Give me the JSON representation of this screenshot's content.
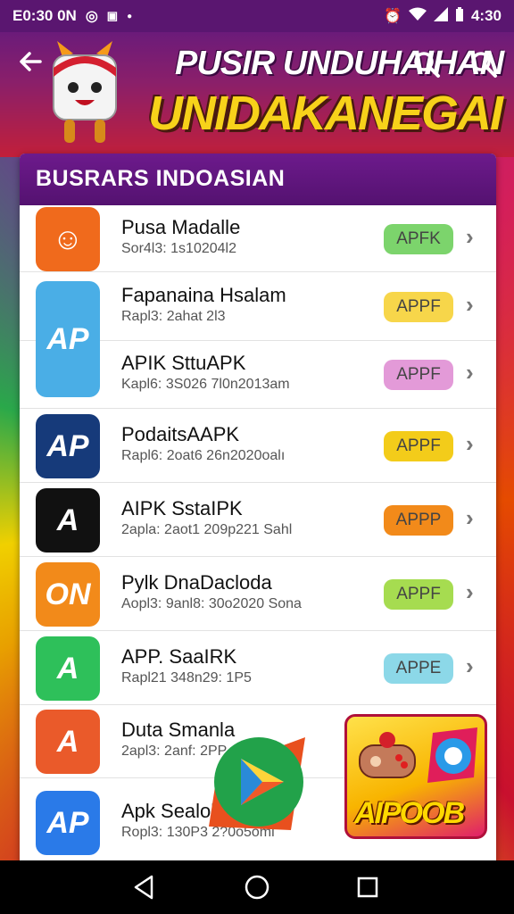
{
  "status_bar": {
    "left_text": "E0:30 0N",
    "time": "4:30"
  },
  "header": {
    "title_line1": "PUSIR UNDUHAIHAN",
    "title_line2": "UNIDAKANEGAI"
  },
  "panel": {
    "title": "BUSRARS INDOASIAN"
  },
  "apps": [
    {
      "name": "Pusa Madalle",
      "meta": "Sor4l3: 1s10204l2",
      "badge": "APFK",
      "badge_color": "#7cd46c",
      "icon_color": "#f06a1c",
      "icon_glyph": "☺"
    },
    {
      "name": "Fapanaina Hsalam",
      "meta": "Rapl3: 2ahat 2l3",
      "badge": "APPF",
      "badge_color": "#f7d64a",
      "icon_color": "#4aaee6",
      "icon_glyph": "AP"
    },
    {
      "name": "APIK SttuAPK",
      "meta": "Kapl6: 3S026 7l0n2013am",
      "badge": "APPF",
      "badge_color": "#e39ad8",
      "icon_color": "#7fcaf0",
      "icon_glyph": ""
    },
    {
      "name": "PodaitsAAPK",
      "meta": "Rapl6: 2oat6 26n2020oalı",
      "badge": "APPF",
      "badge_color": "#f3cc1a",
      "icon_color": "#163a7a",
      "icon_glyph": "AP"
    },
    {
      "name": "AIPK SstaIPK",
      "meta": "2apla: 2aot1 209p221 Sahl",
      "badge": "APPP",
      "badge_color": "#f28a1a",
      "icon_color": "#111111",
      "icon_glyph": "A"
    },
    {
      "name": "Pylk DnaDacloda",
      "meta": "Aopl3: 9anl8: 30o2020 Sona",
      "badge": "APPF",
      "badge_color": "#a6dc50",
      "icon_color": "#f28a1a",
      "icon_glyph": "ON"
    },
    {
      "name": "APP. SaaIRK",
      "meta": "Rapl21 348n29: 1P5",
      "badge": "APPE",
      "badge_color": "#8cd8e8",
      "icon_color": "#2ec05a",
      "icon_glyph": "A"
    },
    {
      "name": "Duta Smanla",
      "meta": "2apl3: 2anf: 2PP",
      "badge": "",
      "badge_color": "#ffffff",
      "icon_color": "#ea5a2a",
      "icon_glyph": "A"
    },
    {
      "name": "Apk Sealol",
      "meta": "Ropl3: 130P3 2?0o5oml",
      "badge": "",
      "badge_color": "#ffffff",
      "icon_color": "#2a7ae8",
      "icon_glyph": "AP"
    }
  ],
  "promo": {
    "label": "AIPOOB"
  },
  "icons": [
    "back-arrow-icon",
    "search-icon",
    "play-store-icon",
    "gamepad-icon",
    "nav-back-icon",
    "nav-home-icon",
    "nav-recents-icon"
  ]
}
